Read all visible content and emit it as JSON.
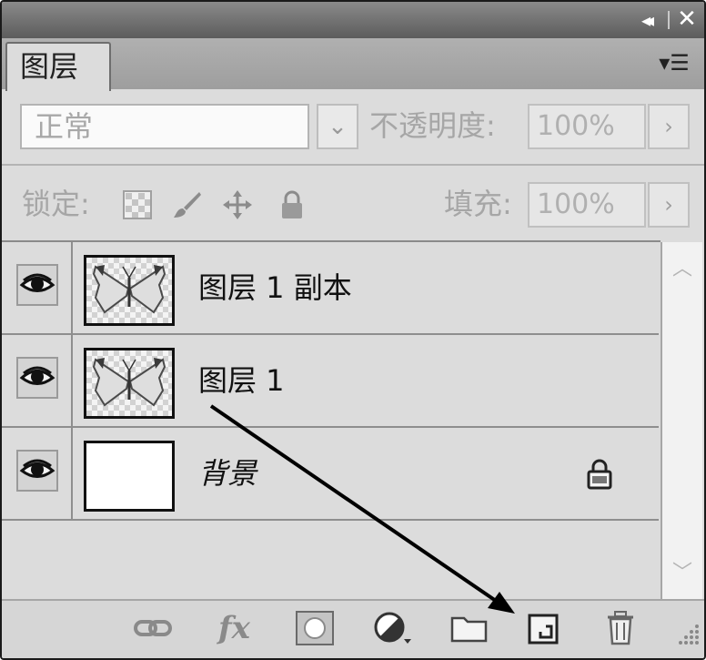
{
  "panel": {
    "tab_label": "图层",
    "collapse_glyph": "◂◂",
    "close_glyph": "✕",
    "menu_glyph": "▾☰"
  },
  "blend": {
    "mode": "正常",
    "arrow_glyph": "⌄",
    "opacity_label": "不透明度:",
    "opacity_value": "100%",
    "opacity_arrow": "›"
  },
  "lock": {
    "label": "锁定:",
    "icons": [
      "lock-transparent-icon",
      "lock-paint-icon",
      "lock-move-icon",
      "lock-all-icon"
    ],
    "fill_label": "填充:",
    "fill_value": "100%",
    "fill_arrow": "›"
  },
  "layers": [
    {
      "name": "图层 1 副本",
      "visible": true,
      "thumbnail": "butterfly",
      "locked": false,
      "italic": false
    },
    {
      "name": "图层 1",
      "visible": true,
      "thumbnail": "butterfly",
      "locked": false,
      "italic": false
    },
    {
      "name": "背景",
      "visible": true,
      "thumbnail": "white",
      "locked": true,
      "italic": true
    }
  ],
  "scrollbar": {
    "up_glyph": "︿",
    "down_glyph": "﹀"
  },
  "footer": {
    "fx_label": "fx",
    "buttons": [
      "link-layers-icon",
      "layer-style-icon",
      "add-mask-icon",
      "adjustment-layer-icon",
      "new-group-icon",
      "new-layer-icon",
      "delete-layer-icon"
    ]
  },
  "colors": {
    "panel_bg": "#dcdcdc",
    "titlebar": "#6e6e6e",
    "disabled_text": "#a6a6a6",
    "layer_text": "#111111"
  }
}
